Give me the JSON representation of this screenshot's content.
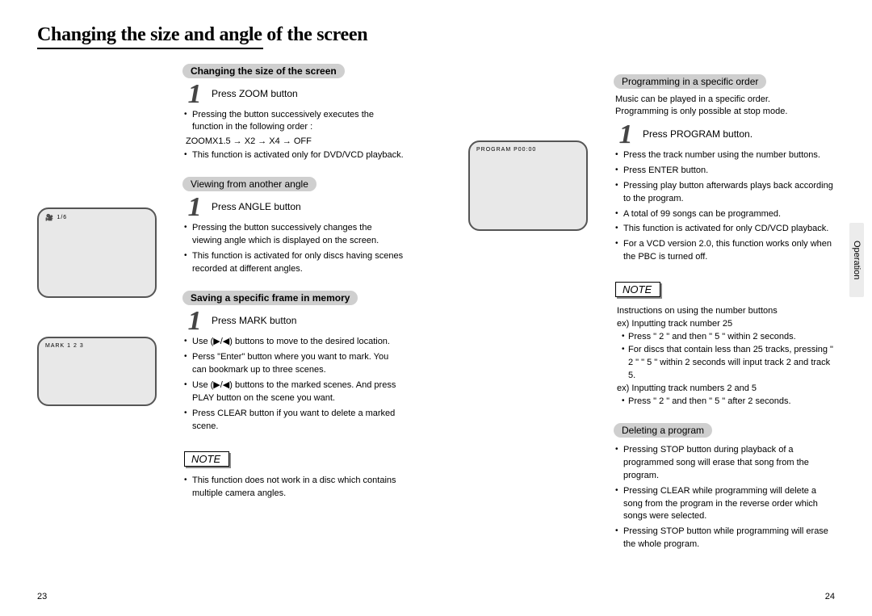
{
  "page": {
    "title": "Changing the size and angle of the screen",
    "left_num": "23",
    "right_num": "24",
    "side_tab": "Operation"
  },
  "zoom": {
    "heading": "Changing the size of the screen",
    "step1": "Press ZOOM button",
    "b1": "Pressing the button successively executes the function in the following order :",
    "seq": "ZOOMX1.5 → X2 → X4 → OFF",
    "b2": "This function is activated only for DVD/VCD playback."
  },
  "angle": {
    "heading": "Viewing from another angle",
    "step1": "Press ANGLE button",
    "b1": "Pressing the button successively changes the viewing angle which is displayed on the screen.",
    "b2": "This function is activated for only discs having scenes recorded at different angles.",
    "scr_label": "1/6"
  },
  "mark": {
    "heading": "Saving a specific frame in memory",
    "step1": "Press MARK button",
    "b1": "Use (▶/◀) buttons to move to the desired location.",
    "b2": "Perss \"Enter\" button where you want to mark. You can bookmark up to three scenes.",
    "b3": "Use (▶/◀) buttons to the marked scenes. And press PLAY button on the scene you want.",
    "b4": "Press CLEAR button if you want to delete a marked scene.",
    "scr_label": "MARK 1 2 3"
  },
  "note_left": {
    "label": "NOTE",
    "b1": "This function does not work in a disc which contains multiple camera angles."
  },
  "program": {
    "heading": "Programming in a specific order",
    "intro1": "Music can be played in a specific order.",
    "intro2": "Programming is only possible at stop mode.",
    "step1": "Press PROGRAM button.",
    "b1": "Press the track number using the number buttons.",
    "b2": "Press ENTER button.",
    "b3": "Pressing play button afterwards plays back according to the program.",
    "b4": "A total of 99 songs can be programmed.",
    "b5": "This function is activated for only CD/VCD playback.",
    "b6": "For a VCD version 2.0, this function works only when the PBC is turned off.",
    "scr_label": "PROGRAM P00:00"
  },
  "note_right": {
    "label": "NOTE",
    "intro": "Instructions on using the number buttons",
    "ex1": "ex) Inputting track number 25",
    "ex1a": "Press \" 2 \" and then \" 5 \" within 2 seconds.",
    "ex1b": "For discs that contain less than 25 tracks, pressing \" 2 \" \" 5 \" within 2 seconds will input track 2 and track 5.",
    "ex2": "ex) Inputting track numbers 2 and 5",
    "ex2a": "Press \" 2 \" and then \" 5 \" after 2 seconds."
  },
  "delete": {
    "heading": "Deleting a program",
    "b1": "Pressing STOP button during playback of a programmed song will erase that song from the program.",
    "b2": "Pressing CLEAR while programming will delete a song from the program in the reverse order which songs were selected.",
    "b3": "Pressing STOP button while programming will erase the whole program."
  }
}
